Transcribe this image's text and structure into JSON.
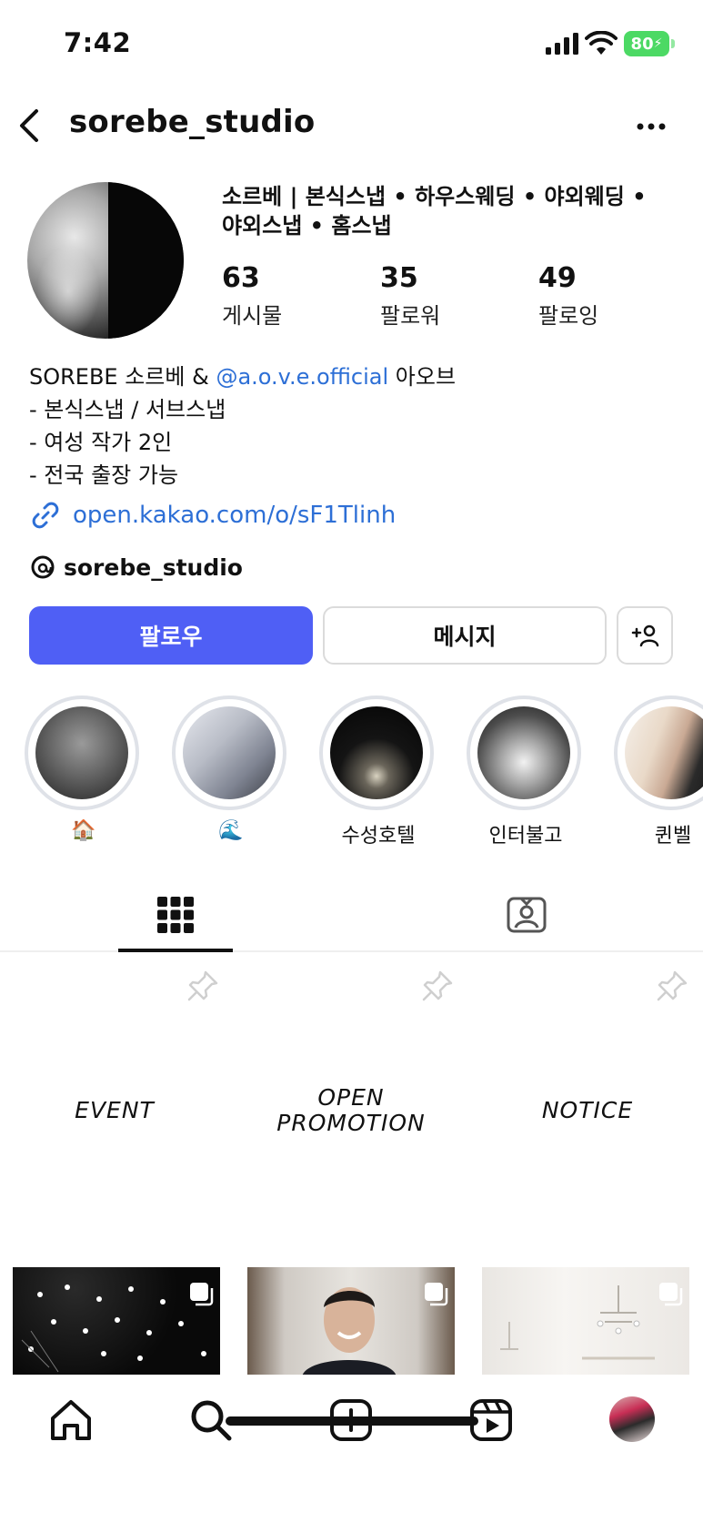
{
  "status_bar": {
    "time": "7:42",
    "battery": "80"
  },
  "header": {
    "username": "sorebe_studio"
  },
  "profile": {
    "full_name_line1": "소르베 | 본식스냅 • 하우스웨딩 • 야외웨딩 •",
    "full_name_line2": "야외스냅 • 홈스냅",
    "stats": [
      {
        "value": "63",
        "label": "게시물"
      },
      {
        "value": "35",
        "label": "팔로워"
      },
      {
        "value": "49",
        "label": "팔로잉"
      }
    ],
    "bio": {
      "line1_prefix": "SOREBE 소르베 & ",
      "line1_mention": "@a.o.v.e.official",
      "line1_suffix": " 아오브",
      "line2": "- 본식스냅 / 서브스냅",
      "line3": "- 여성 작가 2인",
      "line4": "- 전국 출장 가능"
    },
    "link": "open.kakao.com/o/sF1Tlinh",
    "threads": "sorebe_studio"
  },
  "actions": {
    "follow": "팔로우",
    "message": "메시지"
  },
  "highlights": [
    {
      "label": "🏠"
    },
    {
      "label": "🌊"
    },
    {
      "label": "수성호텔"
    },
    {
      "label": "인터불고"
    },
    {
      "label": "퀸벨"
    }
  ],
  "pinned_posts": [
    {
      "text": "EVENT"
    },
    {
      "text_line1": "OPEN",
      "text_line2": "PROMOTION"
    },
    {
      "text": "NOTICE"
    }
  ],
  "colors": {
    "accent": "#4f5ff5",
    "link": "#2d6fd6",
    "battery": "#4cd964"
  }
}
